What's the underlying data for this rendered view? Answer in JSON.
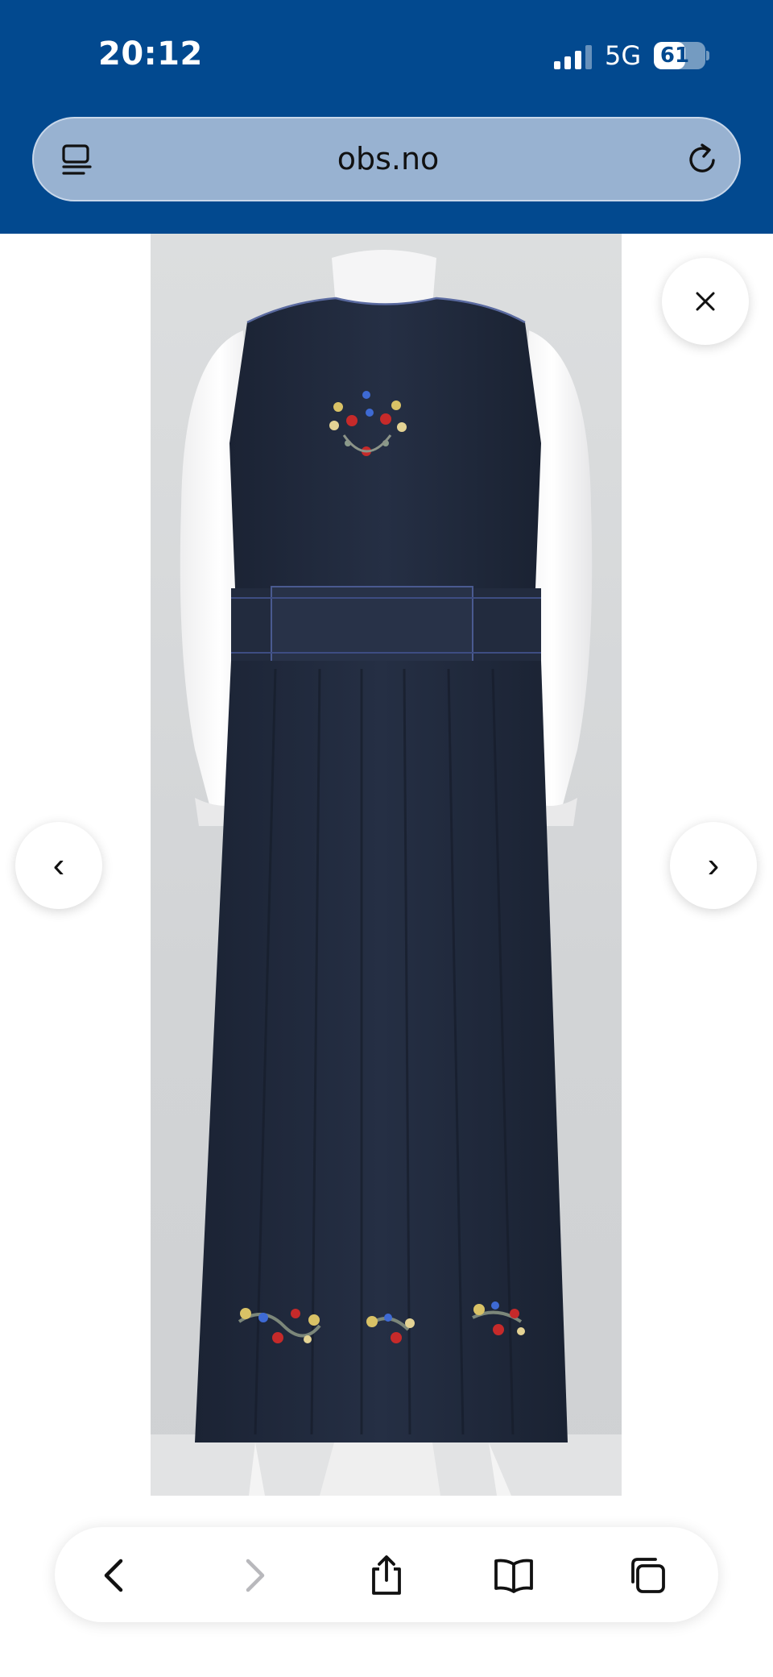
{
  "status_bar": {
    "time": "20:12",
    "network": "5G",
    "battery": "61",
    "battery_level": 0.61,
    "signal_bars": 3,
    "signal_total": 4
  },
  "browser": {
    "url": "obs.no"
  },
  "gallery": {
    "image_alt": "Bunad, back view",
    "close_glyph": "✕",
    "prev_glyph": "‹",
    "next_glyph": "›"
  },
  "toolbar": {
    "items": [
      "back-icon",
      "forward-icon",
      "share-icon",
      "bookmarks-icon",
      "tabs-icon"
    ],
    "forward_enabled": false
  },
  "colors": {
    "brand_blue": "#02498f",
    "url_bar": "#98b2d1",
    "dress_navy": "#212b3d"
  }
}
